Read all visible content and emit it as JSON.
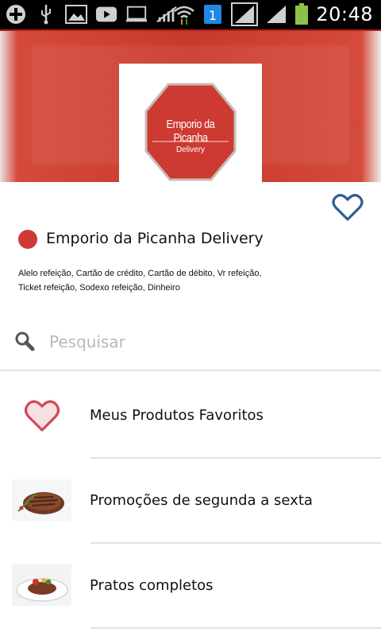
{
  "status_bar": {
    "time": "20:48",
    "sim_badge": "1",
    "icons": [
      "add-icon",
      "usb-icon",
      "image-icon",
      "youtube-icon",
      "monitor-icon",
      "signal-off-icon",
      "wifi-icon",
      "sim-icon",
      "signal-icon",
      "signal-icon",
      "battery-icon"
    ]
  },
  "store": {
    "logo_title": "Emporio da Picanha",
    "logo_subtitle": "Delivery",
    "name": "Emporio da Picanha Delivery",
    "payments": "Alelo refeição, Cartão de crédito, Cartão de débito, Vr refeição, Ticket refeição, Sodexo refeição, Dinheiro",
    "accent_color": "#cf3a36"
  },
  "search": {
    "placeholder": "Pesquisar",
    "value": ""
  },
  "categories": [
    {
      "label": "Meus Produtos Favoritos",
      "icon": "heart-icon"
    },
    {
      "label": "Promoções de segunda a sexta",
      "icon": "steak-image"
    },
    {
      "label": "Pratos completos",
      "icon": "plate-image"
    }
  ]
}
